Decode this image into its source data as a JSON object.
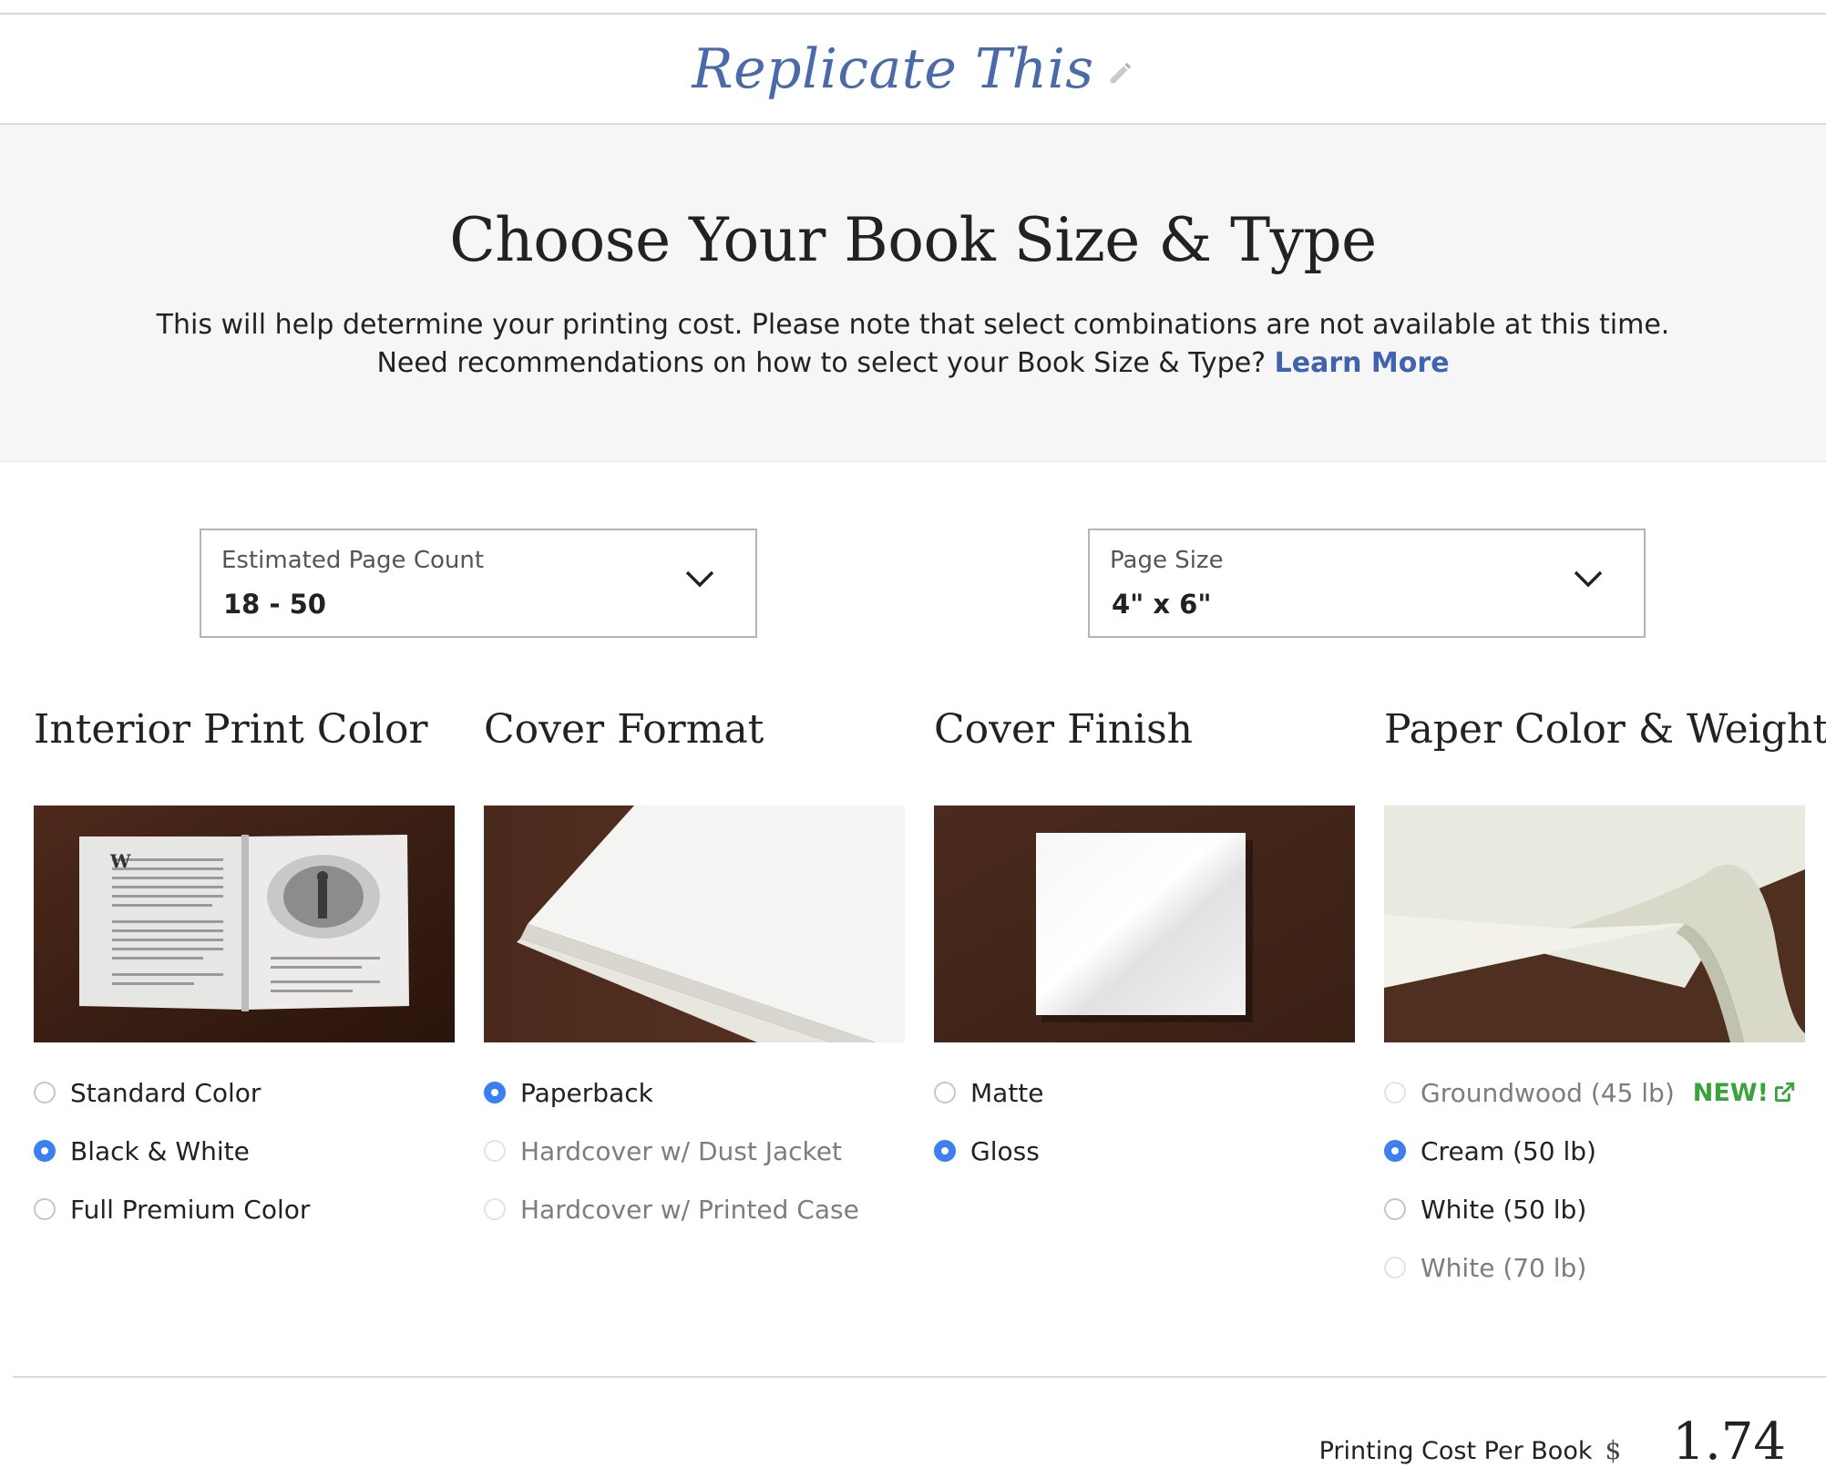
{
  "header": {
    "book_title": "Replicate This"
  },
  "hero": {
    "heading": "Choose Your Book Size & Type",
    "line1": "This will help determine your printing cost. Please note that select combinations are not available at this time.",
    "line2": "Need recommendations on how to select your Book Size & Type?",
    "link": "Learn More"
  },
  "selects": {
    "page_count": {
      "label": "Estimated Page Count",
      "value": "18 - 50"
    },
    "page_size": {
      "label": "Page Size",
      "value": "4\" x 6\""
    }
  },
  "sections": {
    "interior": {
      "title": "Interior Print Color",
      "options": [
        {
          "label": "Standard Color",
          "checked": false,
          "disabled": false
        },
        {
          "label": "Black & White",
          "checked": true,
          "disabled": false
        },
        {
          "label": "Full Premium Color",
          "checked": false,
          "disabled": false
        }
      ]
    },
    "cover_format": {
      "title": "Cover Format",
      "options": [
        {
          "label": "Paperback",
          "checked": true,
          "disabled": false
        },
        {
          "label": "Hardcover w/ Dust Jacket",
          "checked": false,
          "disabled": true
        },
        {
          "label": "Hardcover w/ Printed Case",
          "checked": false,
          "disabled": true
        }
      ]
    },
    "cover_finish": {
      "title": "Cover Finish",
      "options": [
        {
          "label": "Matte",
          "checked": false,
          "disabled": false
        },
        {
          "label": "Gloss",
          "checked": true,
          "disabled": false
        }
      ]
    },
    "paper": {
      "title": "Paper Color & Weight",
      "new_badge": "NEW!",
      "options": [
        {
          "label": "Groundwood (45 lb)",
          "checked": false,
          "disabled": true
        },
        {
          "label": "Cream (50 lb)",
          "checked": true,
          "disabled": false
        },
        {
          "label": "White (50 lb)",
          "checked": false,
          "disabled": false
        },
        {
          "label": "White (70 lb)",
          "checked": false,
          "disabled": true
        }
      ]
    }
  },
  "cost": {
    "label": "Printing Cost Per Book",
    "currency": "$",
    "amount": "1.74"
  },
  "colors": {
    "accent": "#3c7ff0",
    "link": "#3f63ad",
    "title": "#4a6aa8",
    "new": "#3aa33a"
  }
}
